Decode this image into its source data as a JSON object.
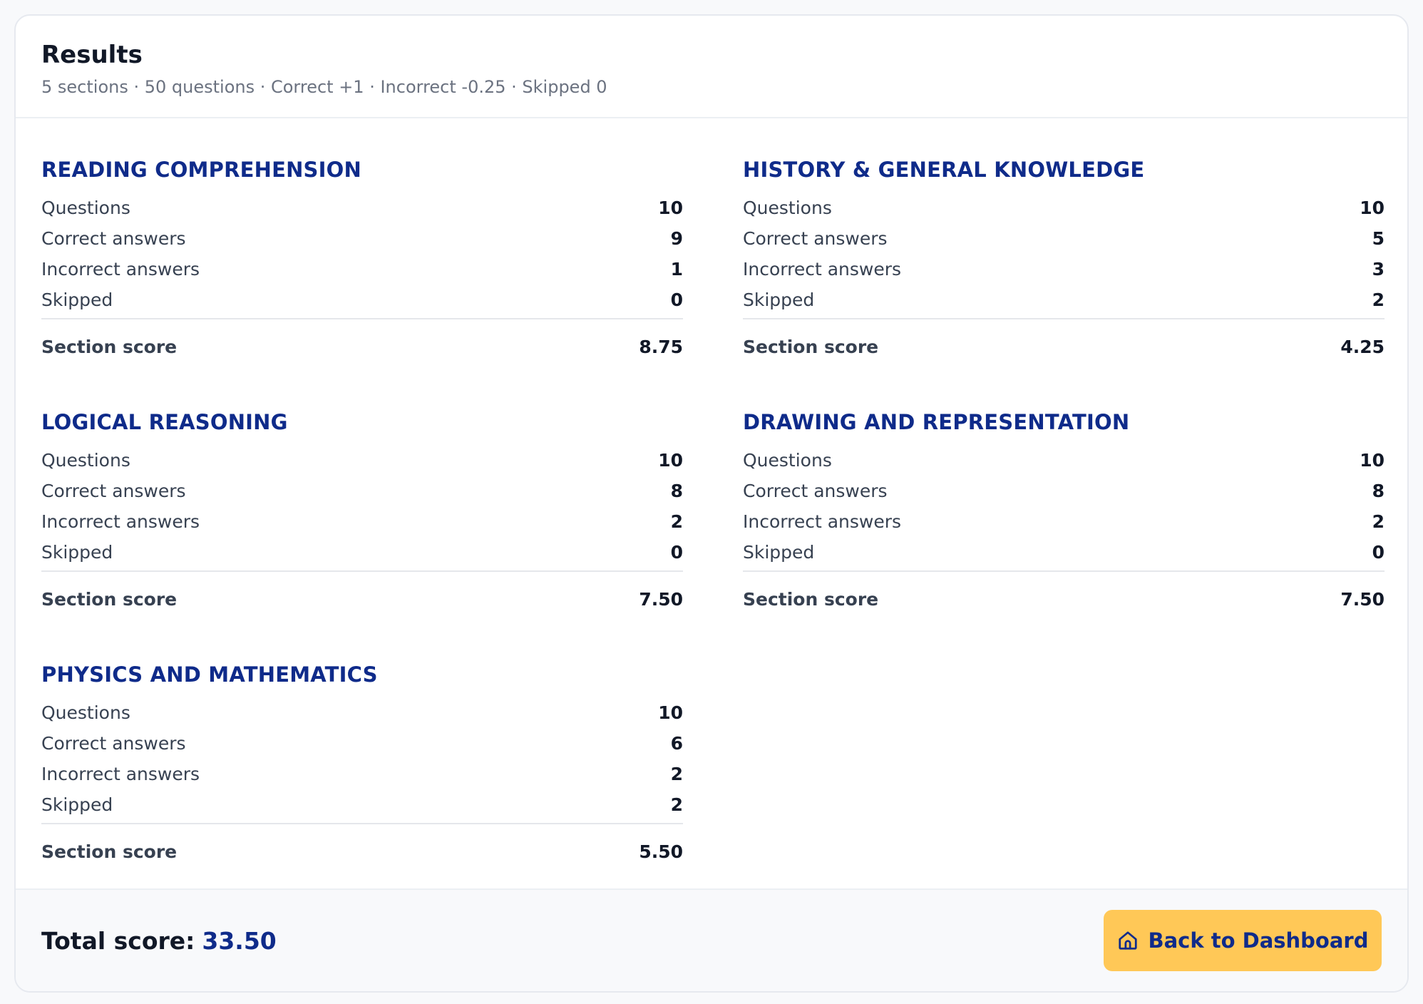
{
  "header": {
    "title": "Results",
    "subtitle": "5 sections · 50 questions · Correct +1 · Incorrect -0.25 · Skipped 0"
  },
  "labels": {
    "questions": "Questions",
    "correct": "Correct answers",
    "incorrect": "Incorrect answers",
    "skipped": "Skipped",
    "section_score": "Section score"
  },
  "sections": [
    {
      "title": "READING COMPREHENSION",
      "questions": "10",
      "correct": "9",
      "incorrect": "1",
      "skipped": "0",
      "score": "8.75"
    },
    {
      "title": "HISTORY & GENERAL KNOWLEDGE",
      "questions": "10",
      "correct": "5",
      "incorrect": "3",
      "skipped": "2",
      "score": "4.25"
    },
    {
      "title": "LOGICAL REASONING",
      "questions": "10",
      "correct": "8",
      "incorrect": "2",
      "skipped": "0",
      "score": "7.50"
    },
    {
      "title": "DRAWING AND REPRESENTATION",
      "questions": "10",
      "correct": "8",
      "incorrect": "2",
      "skipped": "0",
      "score": "7.50"
    },
    {
      "title": "PHYSICS AND MATHEMATICS",
      "questions": "10",
      "correct": "6",
      "incorrect": "2",
      "skipped": "2",
      "score": "5.50"
    }
  ],
  "footer": {
    "total_label": "Total score:",
    "total_value": "33.50",
    "back_button": "Back to Dashboard",
    "back_icon": "home-icon"
  },
  "colors": {
    "accent": "#0f2b8a",
    "button": "#ffc857"
  }
}
